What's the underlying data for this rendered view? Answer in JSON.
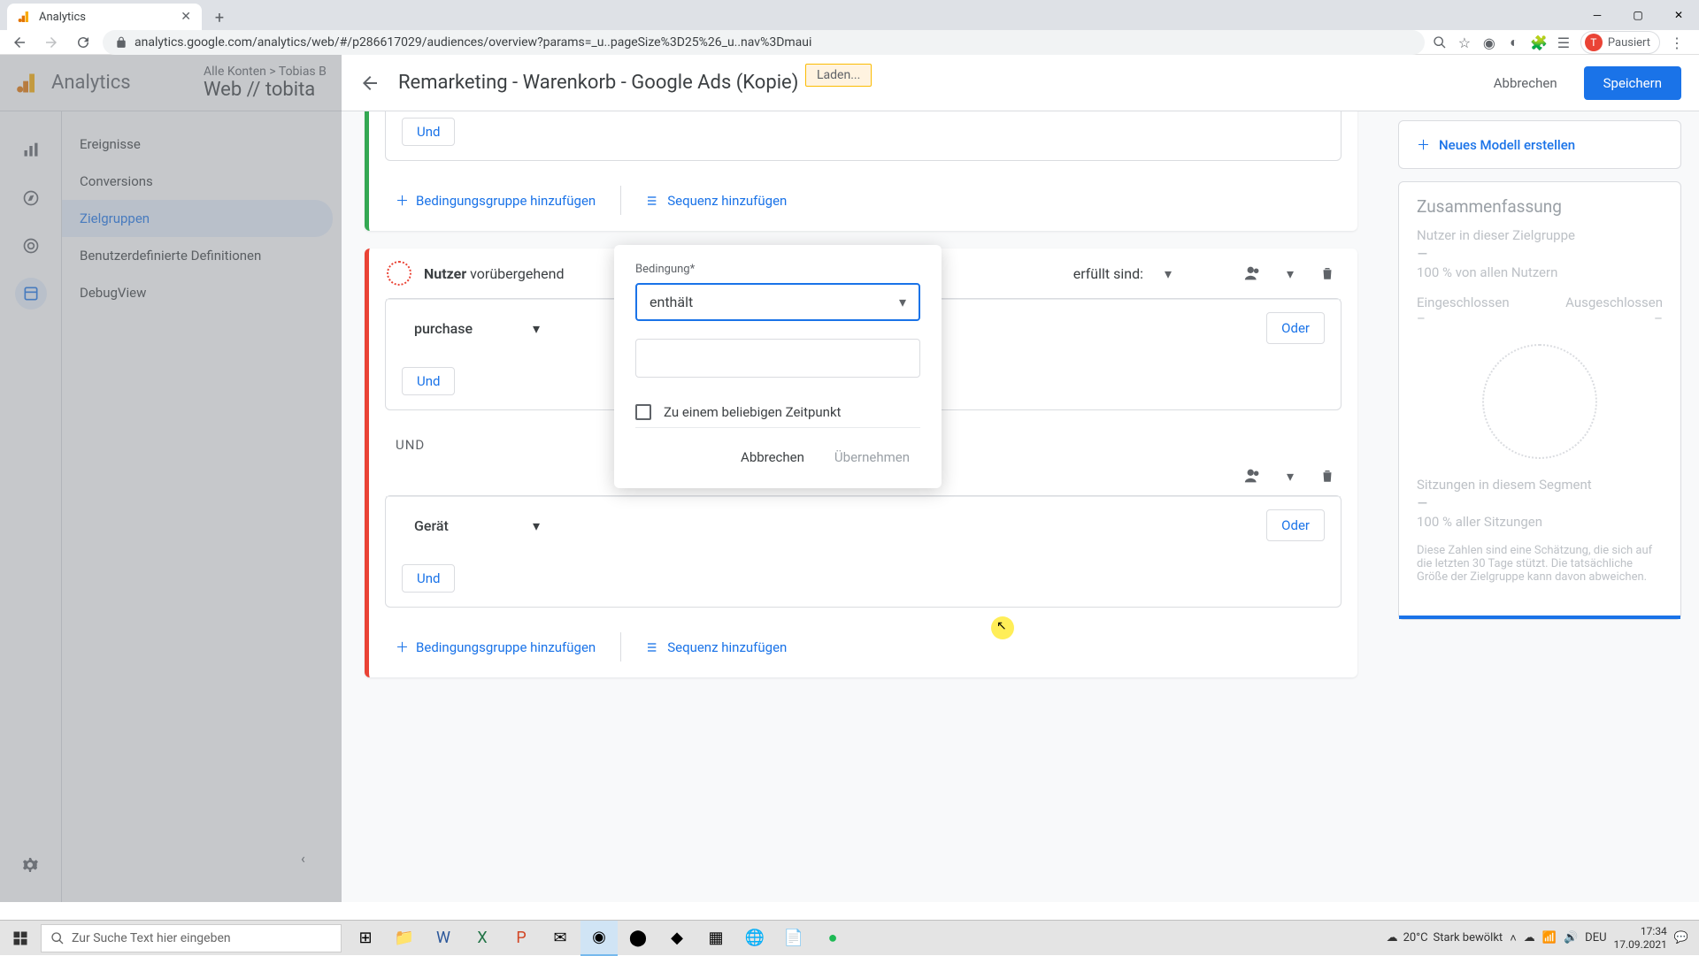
{
  "browser": {
    "tab_title": "Analytics",
    "url": "analytics.google.com/analytics/web/#/p286617029/audiences/overview?params=_u..pageSize%3D25%26_u..nav%3Dmaui",
    "profile_label": "Pausiert",
    "profile_initial": "T"
  },
  "ga_header": {
    "product": "Analytics",
    "crumb_accounts": "Alle Konten",
    "crumb_user": "Tobias B",
    "property": "Web // tobita"
  },
  "panel": {
    "title": "Remarketing - Warenkorb - Google Ads (Kopie)",
    "loading": "Laden...",
    "cancel": "Abbrechen",
    "save": "Speichern"
  },
  "left_nav": {
    "items": [
      "Ereignisse",
      "Conversions",
      "Zielgruppen",
      "Benutzerdefinierte Definitionen",
      "DebugView"
    ],
    "active_index": 2
  },
  "builder": {
    "und": "Und",
    "und_caps": "UND",
    "oder": "Oder",
    "add_group": "Bedingungsgruppe hinzufügen",
    "add_sequence": "Sequenz hinzufügen",
    "exclude_header_pre": "Nutzer",
    "exclude_header_mid": "vorübergehend",
    "exclude_header_post": "erfüllt sind:",
    "param_purchase": "purchase",
    "param_device": "Gerät"
  },
  "popup": {
    "label": "Bedingung*",
    "operator": "enthält",
    "anytime": "Zu einem beliebigen Zeitpunkt",
    "cancel": "Abbrechen",
    "apply": "Übernehmen"
  },
  "side": {
    "new_model": "Neues Modell erstellen",
    "summary_title": "Zusammenfassung",
    "users_in": "Nutzer in dieser Zielgruppe",
    "dash": "–",
    "percent_users": "100 % von allen Nutzern",
    "included": "Eingeschlossen",
    "excluded": "Ausgeschlossen",
    "sessions": "Sitzungen in diesem Segment",
    "percent_sessions": "100 % aller Sitzungen",
    "disclaimer": "Diese Zahlen sind eine Schätzung, die sich auf die letzten 30 Tage stützt. Die tatsächliche Größe der Zielgruppe kann davon abweichen."
  },
  "taskbar": {
    "search_placeholder": "Zur Suche Text hier eingeben",
    "weather_temp": "20°C",
    "weather_cond": "Stark bewölkt",
    "lang": "DEU",
    "time": "17:34",
    "date": "17.09.2021"
  }
}
